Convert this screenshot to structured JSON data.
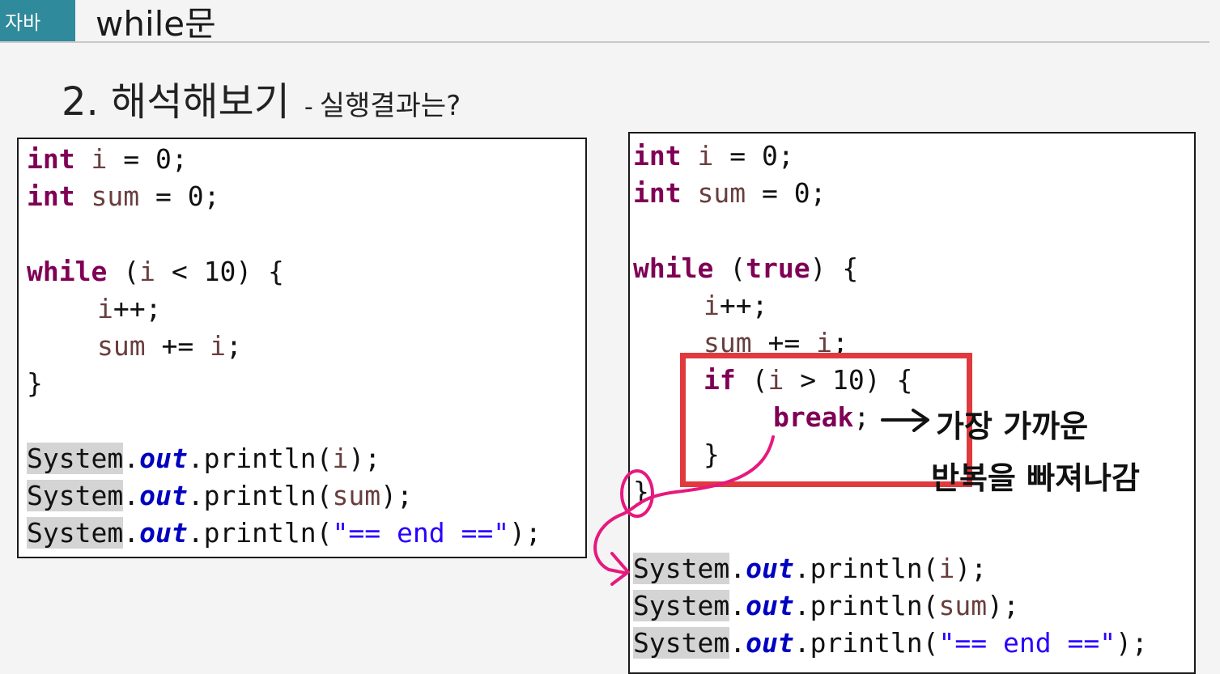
{
  "header": {
    "tag": "자바",
    "topic": "while문"
  },
  "heading": {
    "title": "2. 해석해보기",
    "separator": "-",
    "subtitle": "실행결과는?"
  },
  "left_code": {
    "l1_kw": "int",
    "l1_var": "i",
    "l1_rest": " = 0;",
    "l2_kw": "int",
    "l2_var": "sum",
    "l2_rest": " = 0;",
    "l3_kw": "while",
    "l3_a": " (",
    "l3_var": "i",
    "l3_b": " < 10) {",
    "l4_var": "i",
    "l4_rest": "++;",
    "l5_var1": "sum",
    "l5_mid": " += ",
    "l5_var2": "i",
    "l5_end": ";",
    "l6": "}",
    "p1_sys": "System",
    "p1_dot": ".",
    "p1_out": "out",
    "p1_a": ".println(",
    "p1_var": "i",
    "p1_b": ");",
    "p2_sys": "System",
    "p2_dot": ".",
    "p2_out": "out",
    "p2_a": ".println(",
    "p2_var": "sum",
    "p2_b": ");",
    "p3_sys": "System",
    "p3_dot": ".",
    "p3_out": "out",
    "p3_a": ".println(",
    "p3_str": "\"== end ==\"",
    "p3_b": ");"
  },
  "right_code": {
    "l1_kw": "int",
    "l1_var": "i",
    "l1_rest": " = 0;",
    "l2_kw": "int",
    "l2_var": "sum",
    "l2_rest": " = 0;",
    "l3_kw": "while",
    "l3_a": " (",
    "l3_kw2": "true",
    "l3_b": ") {",
    "l4_var": "i",
    "l4_rest": "++;",
    "l5_var1": "sum",
    "l5_mid": " += ",
    "l5_var2": "i",
    "l5_end": ";",
    "l6_kw": "if",
    "l6_a": " (",
    "l6_var": "i",
    "l6_b": " > 10) {",
    "l7_kw": "break",
    "l7_end": ";",
    "l8": "}",
    "l9": "}",
    "p1_sys": "System",
    "p1_dot": ".",
    "p1_out": "out",
    "p1_a": ".println(",
    "p1_var": "i",
    "p1_b": ");",
    "p2_sys": "System",
    "p2_dot": ".",
    "p2_out": "out",
    "p2_a": ".println(",
    "p2_var": "sum",
    "p2_b": ");",
    "p3_sys": "System",
    "p3_dot": ".",
    "p3_out": "out",
    "p3_a": ".println(",
    "p3_str": "\"== end ==\"",
    "p3_b": ");"
  },
  "annotation": {
    "line1": "가장 가까운",
    "line2": "반복을 빠져나감"
  },
  "colors": {
    "tag_bg": "#2f8a9c",
    "highlight_box": "#e03a3e",
    "pen_arrow": "#e6197e",
    "keyword": "#7f0055",
    "string": "#2a00ff",
    "field": "#0000c0"
  }
}
